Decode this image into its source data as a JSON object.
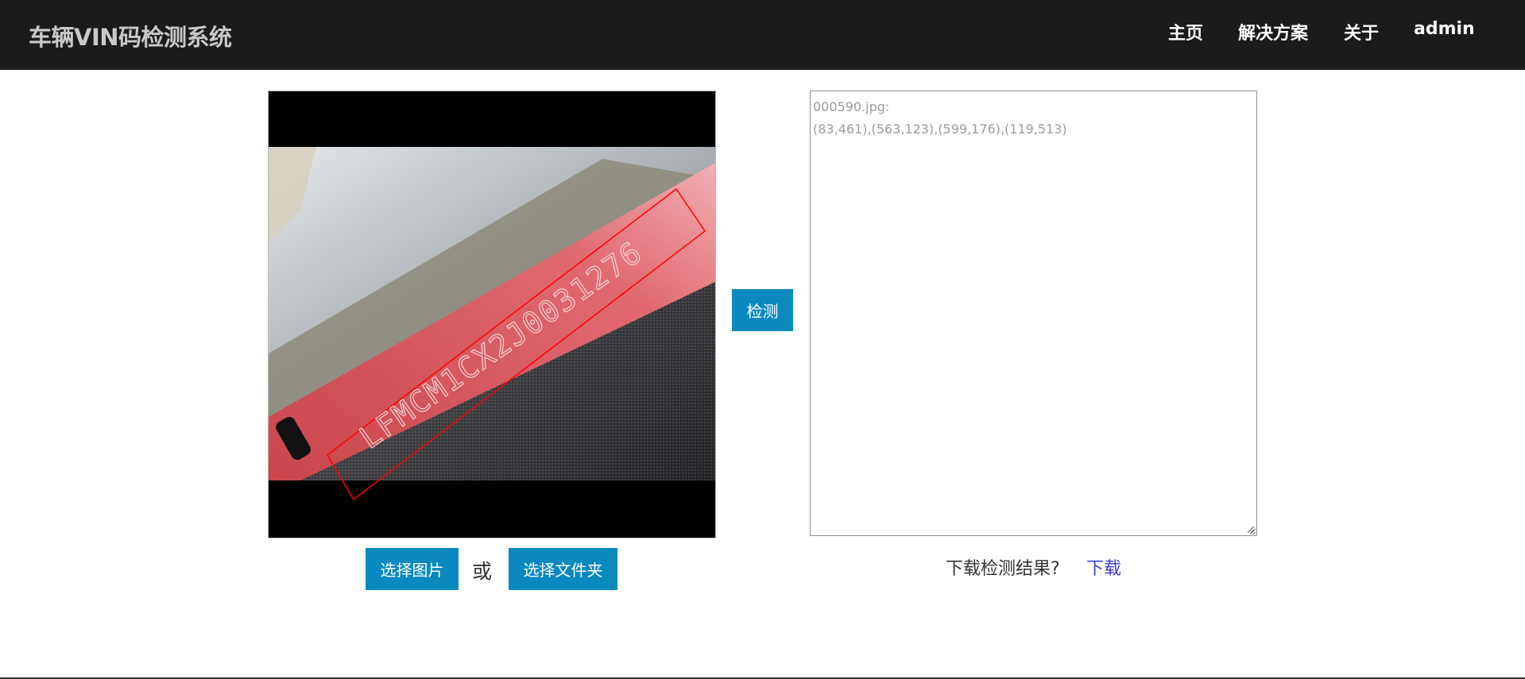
{
  "navbar": {
    "brand": "车辆VIN码检测系统",
    "links": [
      "主页",
      "解决方案",
      "关于",
      "admin"
    ]
  },
  "image_panel": {
    "plate_text": "LFMCM1CX2J0031276",
    "highlight_color": "#ff0000"
  },
  "buttons": {
    "select_image": "选择图片",
    "or": "或",
    "select_folder": "选择文件夹",
    "detect": "检测"
  },
  "result": {
    "lines": [
      "000590.jpg:",
      "(83,461),(563,123),(599,176),(119,513)"
    ]
  },
  "download": {
    "prompt": "下载检测结果?",
    "link": "下载"
  },
  "colors": {
    "navbar_bg": "#1b1b1b",
    "button_bg": "#0a89bf",
    "link": "#3b3bdb"
  }
}
